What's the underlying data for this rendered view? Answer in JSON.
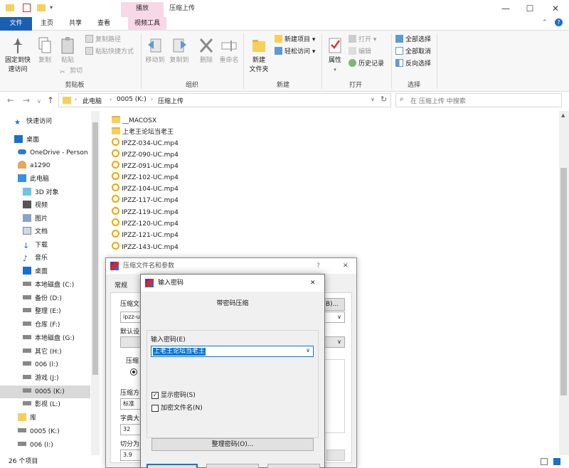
{
  "titlebar": {
    "context_tab": "播放",
    "title": "压缩上传",
    "minimize": "—",
    "maximize": "☐",
    "close": "✕",
    "help": "?"
  },
  "ribbon_tabs": {
    "file": "文件",
    "home": "主页",
    "share": "共享",
    "view": "查看",
    "video_tools": "视频工具"
  },
  "ribbon": {
    "clipboard": {
      "pin_quick_access_1": "固定到快",
      "pin_quick_access_2": "速访问",
      "copy": "复制",
      "paste": "粘贴",
      "copy_path": "复制路径",
      "paste_shortcut": "粘贴快捷方式",
      "cut": "剪切",
      "group_label": "剪贴板"
    },
    "organize": {
      "move_to": "移动到",
      "copy_to": "复制到",
      "delete": "删除",
      "rename": "重命名",
      "group_label": "组织"
    },
    "new": {
      "new_folder_1": "新建",
      "new_folder_2": "文件夹",
      "new_item": "新建项目",
      "easy_access": "轻松访问",
      "group_label": "新建"
    },
    "open": {
      "properties": "属性",
      "open": "打开",
      "edit": "编辑",
      "history": "历史记录",
      "group_label": "打开"
    },
    "select": {
      "select_all": "全部选择",
      "select_none": "全部取消",
      "invert": "反向选择",
      "group_label": "选择"
    }
  },
  "address": {
    "path": [
      "此电脑",
      "0005 (K:)",
      "压缩上传"
    ],
    "search_placeholder": "在 压缩上传 中搜索"
  },
  "nav_pane": {
    "items": [
      "快速访问",
      "桌面",
      "OneDrive - Person",
      "a1290",
      "此电脑",
      "3D 对象",
      "视频",
      "图片",
      "文档",
      "下载",
      "音乐",
      "桌面",
      "本地磁盘 (C:)",
      "备份 (D:)",
      "整理 (E:)",
      "仓库 (F:)",
      "本地磁盘 (G:)",
      "其它 (H:)",
      "006 (I:)",
      "游戏 (J:)",
      "0005 (K:)",
      "影视 (L:)",
      "库",
      "0005 (K:)",
      "006 (I:)"
    ]
  },
  "files": [
    "__MACOSX",
    "上老王论坛当老王",
    "IPZZ-034-UC.mp4",
    "IPZZ-090-UC.mp4",
    "IPZZ-091-UC.mp4",
    "IPZZ-102-UC.mp4",
    "IPZZ-104-UC.mp4",
    "IPZZ-117-UC.mp4",
    "IPZZ-119-UC.mp4",
    "IPZZ-120-UC.mp4",
    "IPZZ-121-UC.mp4",
    "IPZZ-143-UC.mp4"
  ],
  "status": {
    "count": "26 个项目"
  },
  "archive_dialog": {
    "title": "压缩文件名和参数",
    "tab_general": "常规",
    "archive_name_label": "压缩文",
    "archive_name_value": "ipzz-uc",
    "browse_button": "B)...",
    "default_profile_label": "默认设",
    "format_label": "压缩",
    "method_label": "压缩方",
    "method_value": "标准",
    "dict_label": "字典大",
    "dict_value": "32",
    "split_label": "切分为",
    "split_value": "3.9"
  },
  "password_dialog": {
    "title": "输入密码",
    "heading": "带密码压缩",
    "enter_password_label": "输入密码(E)",
    "password_value": "上老王论坛当老王",
    "show_password_label": "显示密码(S)",
    "show_password_checked": true,
    "encrypt_filenames_label": "加密文件名(N)",
    "encrypt_filenames_checked": false,
    "organize_passwords_button": "整理密码(O)...",
    "close": "✕"
  }
}
